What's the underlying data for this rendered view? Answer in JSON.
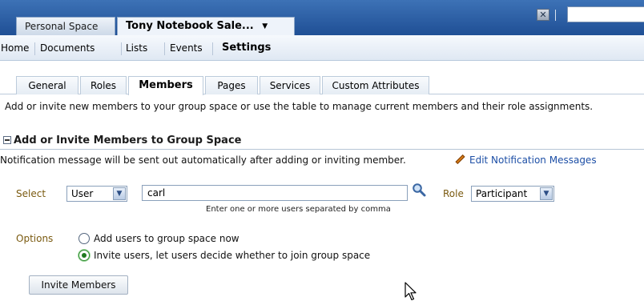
{
  "space_tabs": {
    "inactive": "Personal Space",
    "active": "Tony Notebook Sale..."
  },
  "banner": {
    "close_symbol": "✕"
  },
  "nav": {
    "items": [
      "Home",
      "Documents",
      "Lists",
      "Events",
      "Settings"
    ],
    "selected": "Settings"
  },
  "settings_tabs": {
    "items": [
      "General",
      "Roles",
      "Members",
      "Pages",
      "Services",
      "Custom Attributes"
    ],
    "selected": "Members"
  },
  "intro_text": "Add or invite new members to your group space or use the table to manage current members and their role assignments.",
  "section": {
    "title": "Add or Invite Members to Group Space",
    "notification": "Notification message will be sent out automatically after adding or inviting member.",
    "edit_link": "Edit Notification Messages"
  },
  "form": {
    "select_label": "Select",
    "select_value": "User",
    "users_value": "carl",
    "hint": "Enter one or more users separated by comma",
    "role_label": "Role",
    "role_value": "Participant"
  },
  "options": {
    "label": "Options",
    "add_now": "Add users to group space now",
    "invite": "Invite users, let users decide whether to join group space",
    "selected": "invite"
  },
  "invite_button": "Invite Members",
  "colors": {
    "banner": "#2a5ca4",
    "label": "#7a5a10",
    "link": "#1d4fa6"
  }
}
